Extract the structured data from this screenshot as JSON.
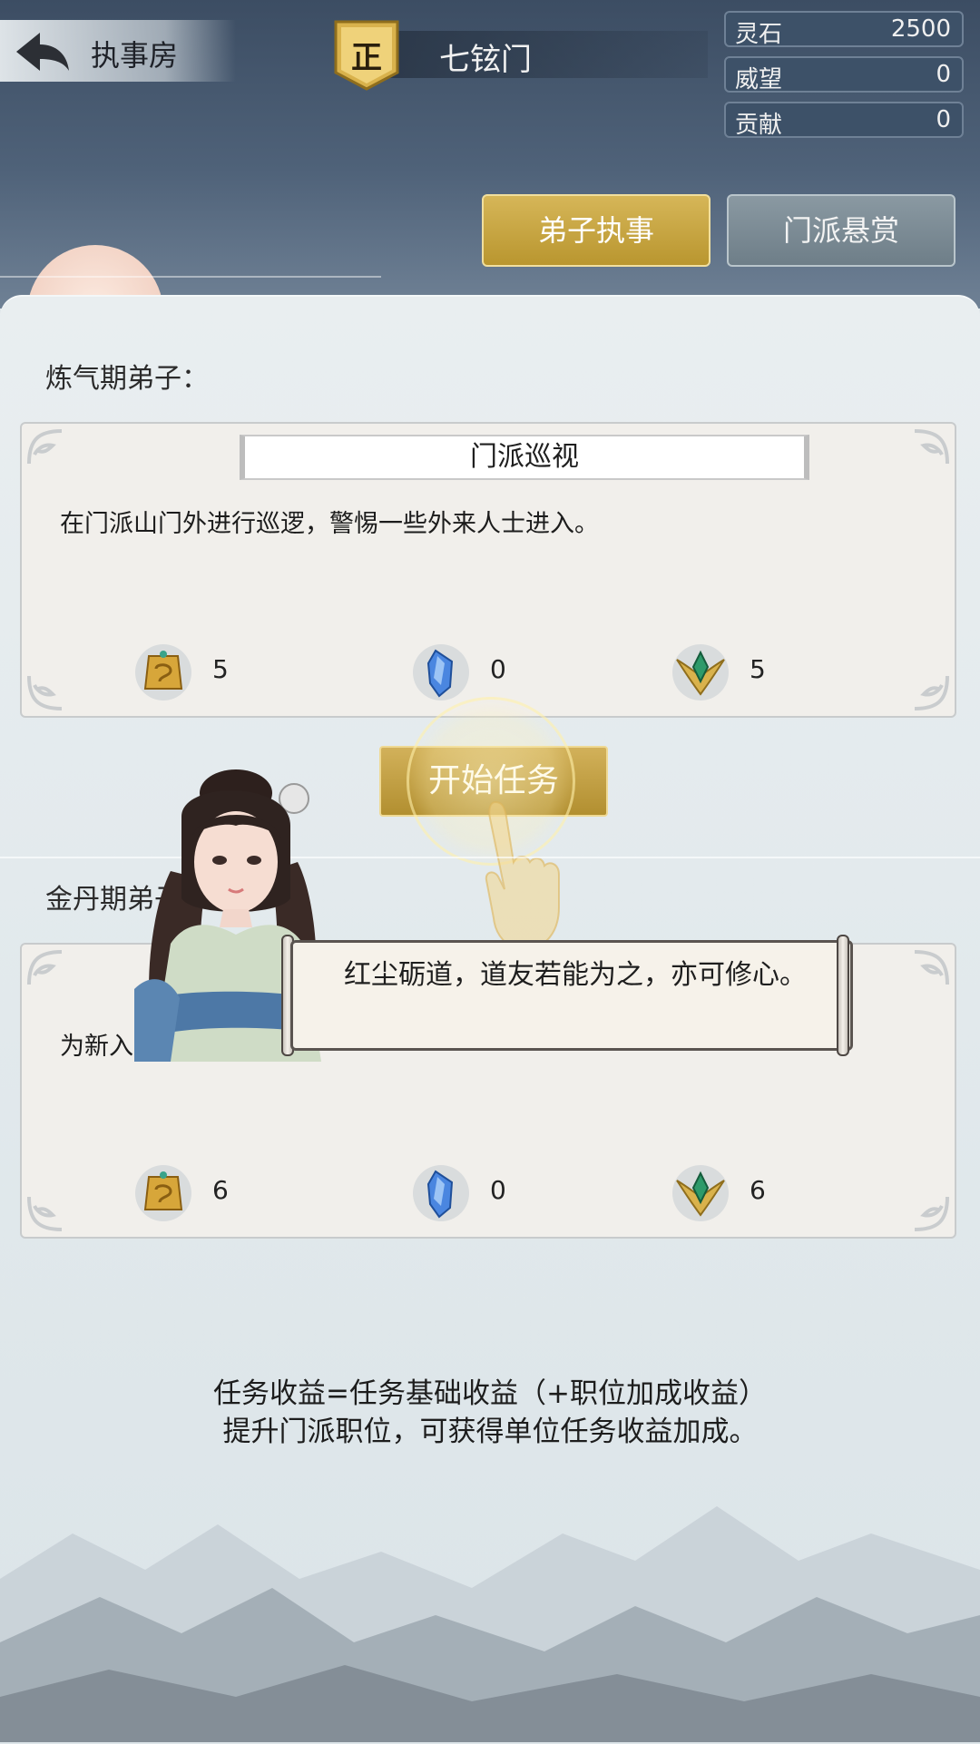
{
  "header": {
    "back_label": "执事房",
    "sect_badge": "正",
    "sect_name": "七铉门"
  },
  "resources": [
    {
      "label": "灵石",
      "value": "2500"
    },
    {
      "label": "威望",
      "value": "0"
    },
    {
      "label": "贡献",
      "value": "0"
    }
  ],
  "tabs": [
    {
      "label": "弟子执事",
      "active": true
    },
    {
      "label": "门派悬赏",
      "active": false
    }
  ],
  "sections": [
    {
      "label": "炼气期弟子：",
      "task": {
        "title": "门派巡视",
        "desc": "在门派山门外进行巡逻，警惕一些外来人士进入。",
        "rewards": [
          {
            "icon": "contribution-token-icon",
            "value": "5"
          },
          {
            "icon": "spirit-stone-icon",
            "value": "0"
          },
          {
            "icon": "prestige-emblem-icon",
            "value": "5"
          }
        ]
      }
    },
    {
      "label": "金丹期弟子",
      "task": {
        "desc": "为新入门的弟子讲",
        "rewards": [
          {
            "icon": "contribution-token-icon",
            "value": "6"
          },
          {
            "icon": "spirit-stone-icon",
            "value": "0"
          },
          {
            "icon": "prestige-emblem-icon",
            "value": "6"
          }
        ]
      }
    }
  ],
  "start_button": "开始任务",
  "guide": {
    "dialog": "红尘砺道，道友若能为之，亦可修心。"
  },
  "footer": {
    "line1": "任务收益=任务基础收益（+职位加成收益）",
    "line2": "提升门派职位，可获得单位任务收益加成。"
  },
  "colors": {
    "gold": "#c9a846",
    "slate": "#3d5168"
  }
}
